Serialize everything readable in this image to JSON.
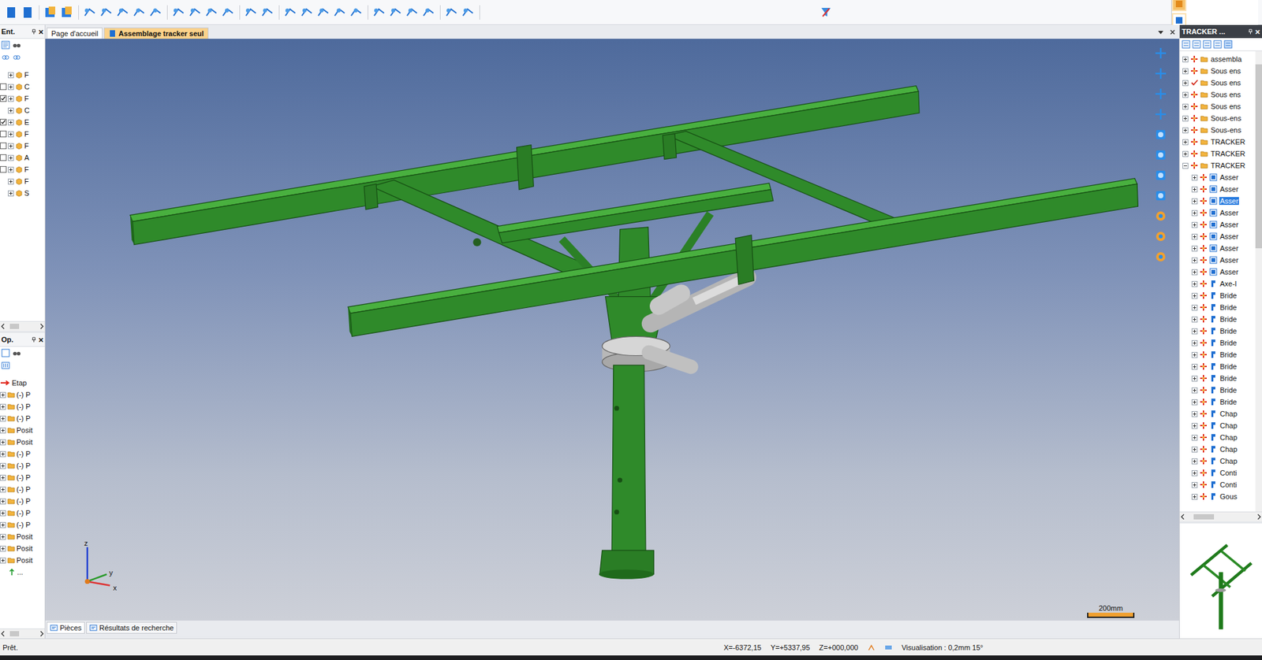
{
  "doc_tabs": [
    {
      "label": "Page d'accueil",
      "selected": false
    },
    {
      "label": "Assemblage tracker seul",
      "selected": true
    }
  ],
  "left_top_panel": {
    "title": "Ent.",
    "close": "×",
    "items": [
      {
        "label": "F",
        "kind": "plain",
        "checked": false
      },
      {
        "label": "C",
        "kind": "check",
        "checked": false
      },
      {
        "label": "F",
        "kind": "check",
        "checked": true
      },
      {
        "label": "C",
        "kind": "plain",
        "checked": false
      },
      {
        "label": "E",
        "kind": "check",
        "checked": true
      },
      {
        "label": "F",
        "kind": "check",
        "checked": false
      },
      {
        "label": "F",
        "kind": "check",
        "checked": false
      },
      {
        "label": "A",
        "kind": "check",
        "checked": false
      },
      {
        "label": "F",
        "kind": "check",
        "checked": false
      },
      {
        "label": "F",
        "kind": "plain",
        "checked": false
      },
      {
        "label": "S",
        "kind": "plain",
        "checked": false
      }
    ]
  },
  "left_bottom_panel": {
    "title": "Op.",
    "close": "×",
    "items": [
      {
        "label": "Etap",
        "kind": "step"
      },
      {
        "label": "(-) P",
        "kind": "folder"
      },
      {
        "label": "(-) P",
        "kind": "folder"
      },
      {
        "label": "(-) P",
        "kind": "folder"
      },
      {
        "label": "Posit",
        "kind": "folder"
      },
      {
        "label": "Posit",
        "kind": "folder"
      },
      {
        "label": "(-) P",
        "kind": "folder"
      },
      {
        "label": "(-) P",
        "kind": "folder"
      },
      {
        "label": "(-) P",
        "kind": "folder"
      },
      {
        "label": "(-) P",
        "kind": "folder"
      },
      {
        "label": "(-) P",
        "kind": "folder"
      },
      {
        "label": "(-) P",
        "kind": "folder"
      },
      {
        "label": "(-) P",
        "kind": "folder"
      },
      {
        "label": "Posit",
        "kind": "folder"
      },
      {
        "label": "Posit",
        "kind": "folder"
      },
      {
        "label": "Posit",
        "kind": "folder"
      },
      {
        "label": "...",
        "kind": "up"
      }
    ]
  },
  "right_panel": {
    "title": "TRACKER ...",
    "close": "×",
    "tree": [
      {
        "label": "assembla",
        "level": 0,
        "kind": "folder",
        "expanded": false,
        "checked": false,
        "selected": false
      },
      {
        "label": "Sous ens",
        "level": 0,
        "kind": "folder",
        "expanded": false,
        "checked": false,
        "selected": false
      },
      {
        "label": "Sous ens",
        "level": 0,
        "kind": "folder",
        "expanded": false,
        "checked": true,
        "selected": false
      },
      {
        "label": "Sous ens",
        "level": 0,
        "kind": "folder",
        "expanded": false,
        "checked": false,
        "selected": false
      },
      {
        "label": "Sous ens",
        "level": 0,
        "kind": "folder",
        "expanded": false,
        "checked": false,
        "selected": false
      },
      {
        "label": "Sous-ens",
        "level": 0,
        "kind": "folder",
        "expanded": false,
        "checked": false,
        "selected": false
      },
      {
        "label": "Sous-ens",
        "level": 0,
        "kind": "folder",
        "expanded": false,
        "checked": false,
        "selected": false
      },
      {
        "label": "TRACKER",
        "level": 0,
        "kind": "folder",
        "expanded": false,
        "checked": false,
        "selected": false
      },
      {
        "label": "TRACKER",
        "level": 0,
        "kind": "folder",
        "expanded": false,
        "checked": false,
        "selected": false
      },
      {
        "label": "TRACKER",
        "level": 0,
        "kind": "folder",
        "expanded": true,
        "checked": false,
        "selected": false
      },
      {
        "label": "Asser",
        "level": 1,
        "kind": "assembly",
        "expanded": false,
        "checked": false,
        "selected": false
      },
      {
        "label": "Asser",
        "level": 1,
        "kind": "assembly",
        "expanded": false,
        "checked": false,
        "selected": false
      },
      {
        "label": "Asser",
        "level": 1,
        "kind": "assembly",
        "expanded": false,
        "checked": false,
        "selected": true
      },
      {
        "label": "Asser",
        "level": 1,
        "kind": "assembly",
        "expanded": false,
        "checked": false,
        "selected": false
      },
      {
        "label": "Asser",
        "level": 1,
        "kind": "assembly",
        "expanded": false,
        "checked": false,
        "selected": false
      },
      {
        "label": "Asser",
        "level": 1,
        "kind": "assembly",
        "expanded": false,
        "checked": false,
        "selected": false
      },
      {
        "label": "Asser",
        "level": 1,
        "kind": "assembly",
        "expanded": false,
        "checked": false,
        "selected": false
      },
      {
        "label": "Asser",
        "level": 1,
        "kind": "assembly",
        "expanded": false,
        "checked": false,
        "selected": false
      },
      {
        "label": "Asser",
        "level": 1,
        "kind": "assembly",
        "expanded": false,
        "checked": false,
        "selected": false
      },
      {
        "label": "Axe-I",
        "level": 1,
        "kind": "part",
        "expanded": false,
        "checked": false,
        "selected": false
      },
      {
        "label": "Bride",
        "level": 1,
        "kind": "part",
        "expanded": false,
        "checked": false,
        "selected": false
      },
      {
        "label": "Bride",
        "level": 1,
        "kind": "part",
        "expanded": false,
        "checked": false,
        "selected": false
      },
      {
        "label": "Bride",
        "level": 1,
        "kind": "part",
        "expanded": false,
        "checked": false,
        "selected": false
      },
      {
        "label": "Bride",
        "level": 1,
        "kind": "part",
        "expanded": false,
        "checked": false,
        "selected": false
      },
      {
        "label": "Bride",
        "level": 1,
        "kind": "part",
        "expanded": false,
        "checked": false,
        "selected": false
      },
      {
        "label": "Bride",
        "level": 1,
        "kind": "part",
        "expanded": false,
        "checked": false,
        "selected": false
      },
      {
        "label": "Bride",
        "level": 1,
        "kind": "part",
        "expanded": false,
        "checked": false,
        "selected": false
      },
      {
        "label": "Bride",
        "level": 1,
        "kind": "part",
        "expanded": false,
        "checked": false,
        "selected": false
      },
      {
        "label": "Bride",
        "level": 1,
        "kind": "part",
        "expanded": false,
        "checked": false,
        "selected": false
      },
      {
        "label": "Bride",
        "level": 1,
        "kind": "part",
        "expanded": false,
        "checked": false,
        "selected": false
      },
      {
        "label": "Chap",
        "level": 1,
        "kind": "part",
        "expanded": false,
        "checked": false,
        "selected": false
      },
      {
        "label": "Chap",
        "level": 1,
        "kind": "part",
        "expanded": false,
        "checked": false,
        "selected": false
      },
      {
        "label": "Chap",
        "level": 1,
        "kind": "part",
        "expanded": false,
        "checked": false,
        "selected": false
      },
      {
        "label": "Chap",
        "level": 1,
        "kind": "part",
        "expanded": false,
        "checked": false,
        "selected": false
      },
      {
        "label": "Chap",
        "level": 1,
        "kind": "part",
        "expanded": false,
        "checked": false,
        "selected": false
      },
      {
        "label": "Conti",
        "level": 1,
        "kind": "part",
        "expanded": false,
        "checked": false,
        "selected": false
      },
      {
        "label": "Conti",
        "level": 1,
        "kind": "part",
        "expanded": false,
        "checked": false,
        "selected": false
      },
      {
        "label": "Gous",
        "level": 1,
        "kind": "part",
        "expanded": false,
        "checked": false,
        "selected": false
      }
    ]
  },
  "viewport": {
    "scale": "200mm",
    "axes": [
      "z",
      "y",
      "x"
    ]
  },
  "bottom_tabs": [
    {
      "label": "Pièces",
      "selected": true
    },
    {
      "label": "Résultats de recherche",
      "selected": false
    }
  ],
  "status_bar": {
    "message": "Prêt.",
    "x": "X=-6372,15",
    "y": "Y=+5337,95",
    "z": "Z=+000,000",
    "view": "Visualisation : 0,2mm 15°"
  }
}
